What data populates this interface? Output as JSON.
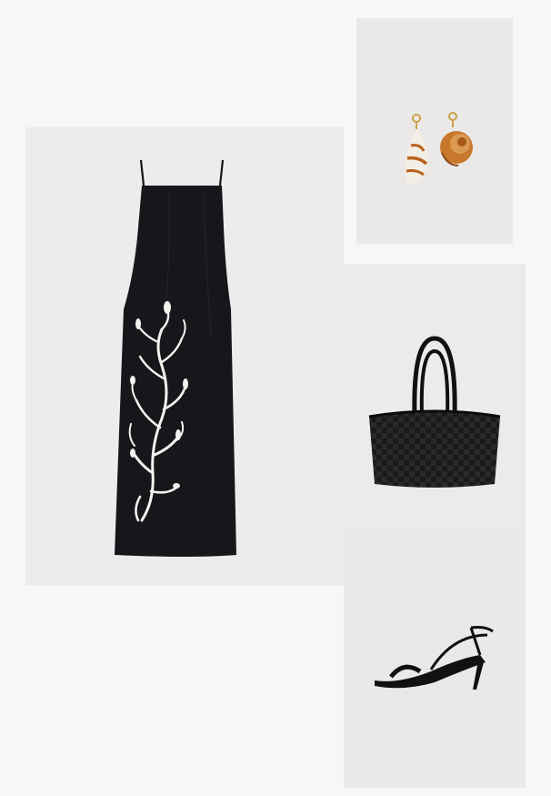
{
  "board": {
    "background": "#f7f7f7",
    "items": [
      {
        "name": "dress",
        "color": "#15171a",
        "print_color": "#f2f2ee"
      },
      {
        "name": "earrings",
        "accent": "#b8621e"
      },
      {
        "name": "bag",
        "color": "#1a1a1a"
      },
      {
        "name": "sandal",
        "color": "#111111"
      }
    ]
  }
}
